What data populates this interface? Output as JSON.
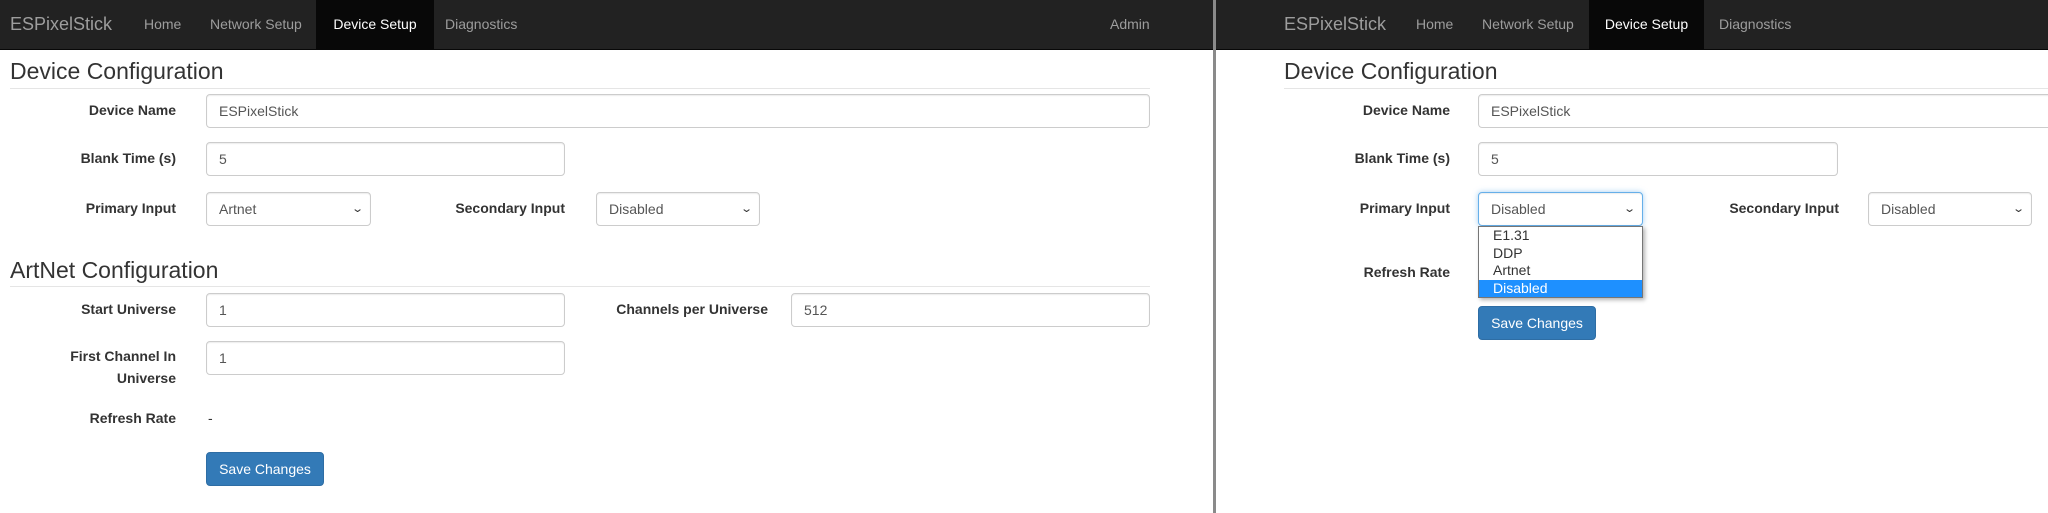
{
  "left": {
    "navbar": {
      "brand": "ESPixelStick",
      "items": [
        "Home",
        "Network Setup",
        "Device Setup",
        "Diagnostics"
      ],
      "active": "Device Setup",
      "admin": "Admin"
    },
    "device_config": {
      "title": "Device Configuration",
      "device_name": {
        "label": "Device Name",
        "value": "ESPixelStick"
      },
      "blank_time": {
        "label": "Blank Time (s)",
        "value": "5"
      },
      "primary_input": {
        "label": "Primary Input",
        "value": "Artnet"
      },
      "secondary_input": {
        "label": "Secondary Input",
        "value": "Disabled"
      }
    },
    "artnet": {
      "title": "ArtNet Configuration",
      "start_universe": {
        "label": "Start Universe",
        "value": "1"
      },
      "channels_per_universe": {
        "label": "Channels per Universe",
        "value": "512"
      },
      "first_channel": {
        "label_line1": "First Channel In",
        "label_line2": "Universe",
        "value": "1"
      },
      "refresh_rate": {
        "label": "Refresh Rate",
        "value": "-"
      }
    },
    "save_label": "Save Changes"
  },
  "right": {
    "navbar": {
      "brand": "ESPixelStick",
      "items": [
        "Home",
        "Network Setup",
        "Device Setup",
        "Diagnostics"
      ],
      "active": "Device Setup"
    },
    "device_config": {
      "title": "Device Configuration",
      "device_name": {
        "label": "Device Name",
        "value": "ESPixelStick"
      },
      "blank_time": {
        "label": "Blank Time (s)",
        "value": "5"
      },
      "primary_input": {
        "label": "Primary Input",
        "value": "Disabled",
        "options": [
          "E1.31",
          "DDP",
          "Artnet",
          "Disabled"
        ],
        "highlighted": "Disabled"
      },
      "secondary_input": {
        "label": "Secondary Input",
        "value": "Disabled"
      },
      "refresh_rate": {
        "label": "Refresh Rate"
      }
    },
    "save_label": "Save Changes"
  },
  "colors": {
    "navbar": "#222222",
    "active_tab": "#080808",
    "primary_button": "#337ab7",
    "highlight": "#1e90ff"
  }
}
